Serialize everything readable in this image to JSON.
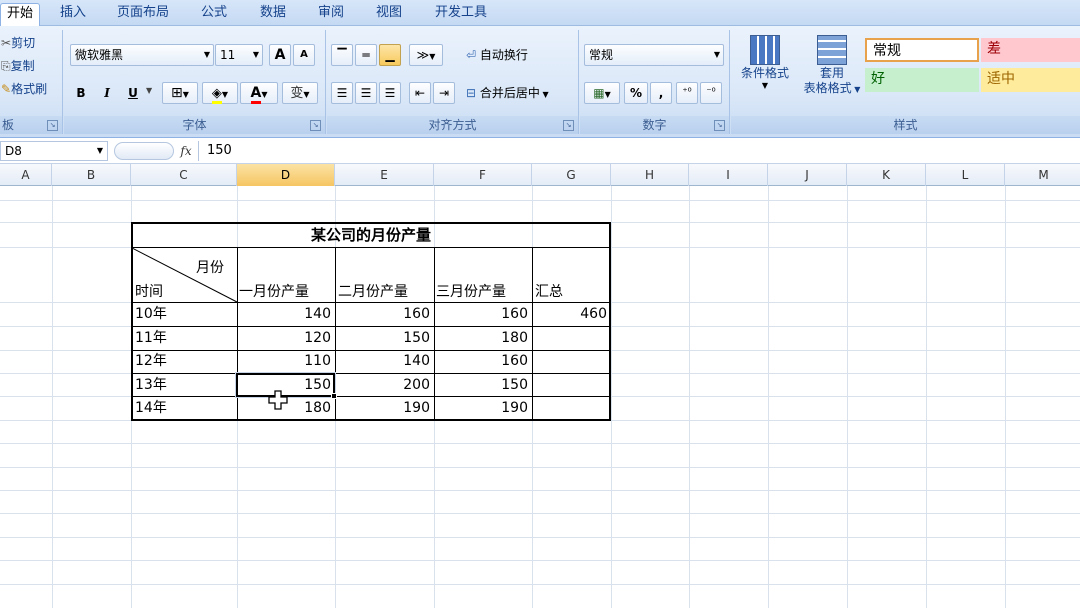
{
  "tabs": [
    "开始",
    "插入",
    "页面布局",
    "公式",
    "数据",
    "审阅",
    "视图",
    "开发工具"
  ],
  "clipboard": {
    "cut": "剪切",
    "copy": "复制",
    "painter": "格式刷",
    "label": "板"
  },
  "font": {
    "name": "微软雅黑",
    "size": "11",
    "grow": "A",
    "shrink": "A",
    "bold": "B",
    "italic": "I",
    "underline": "U",
    "color_letter": "A",
    "phonetic": "变",
    "label": "字体"
  },
  "align": {
    "wrap": "自动换行",
    "merge": "合并后居中",
    "label": "对齐方式"
  },
  "number": {
    "format": "常规",
    "percent": "%",
    "comma": ",",
    "label": "数字"
  },
  "styles": {
    "cond": "条件格式",
    "table1": "套用",
    "table2": "表格格式",
    "normal": "常规",
    "bad": "差",
    "good": "好",
    "neutral": "适中",
    "label": "样式"
  },
  "formula": {
    "namebox": "D8",
    "fx": "fx",
    "value": "150"
  },
  "columns": [
    "A",
    "B",
    "C",
    "D",
    "E",
    "F",
    "G",
    "H",
    "I",
    "J",
    "K",
    "L",
    "M"
  ],
  "table": {
    "title": "某公司的月份产量",
    "corner_top": "月份",
    "corner_bottom": "时间",
    "headers": [
      "一月份产量",
      "二月份产量",
      "三月份产量",
      "汇总"
    ],
    "rows": [
      {
        "year": "10年",
        "m1": "140",
        "m2": "160",
        "m3": "160",
        "sum": "460"
      },
      {
        "year": "11年",
        "m1": "120",
        "m2": "150",
        "m3": "180",
        "sum": ""
      },
      {
        "year": "12年",
        "m1": "110",
        "m2": "140",
        "m3": "160",
        "sum": ""
      },
      {
        "year": "13年",
        "m1": "150",
        "m2": "200",
        "m3": "150",
        "sum": ""
      },
      {
        "year": "14年",
        "m1": "180",
        "m2": "190",
        "m3": "190",
        "sum": ""
      }
    ]
  },
  "colors": {
    "accent": "#f6c562",
    "bad_bg": "#ffc7ce",
    "bad_fg": "#9c0006",
    "good_bg": "#c6efce",
    "good_fg": "#006100",
    "neutral_bg": "#ffeb9c",
    "neutral_fg": "#9c6500"
  }
}
